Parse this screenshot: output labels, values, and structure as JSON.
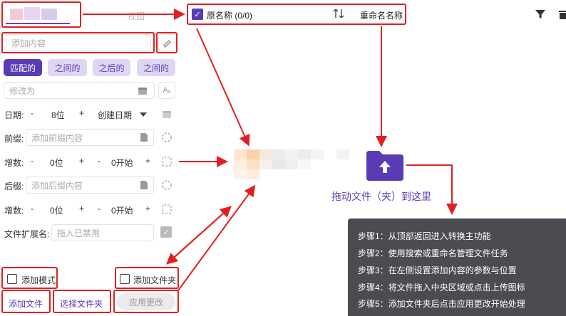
{
  "tabs": {
    "second": "视图"
  },
  "add_content": {
    "placeholder": "添加内容"
  },
  "modes": [
    {
      "label": "匹配的",
      "active": true
    },
    {
      "label": "之间的",
      "active": false
    },
    {
      "label": "之后的",
      "active": false
    },
    {
      "label": "之间的",
      "active": false
    }
  ],
  "modify": {
    "placeholder": "修改为",
    "case_toggle": "Aₒ"
  },
  "date": {
    "label": "日期:",
    "minus": "-",
    "value": "8位",
    "plus": "+",
    "type": "创建日期"
  },
  "prefix": {
    "label": "前缀:",
    "placeholder": "添加前缀内容"
  },
  "increment1": {
    "label": "增数:",
    "minus1": "-",
    "digits": "0位",
    "plus1": "+",
    "minus2": "-",
    "start": "0开始",
    "plus2": "+"
  },
  "suffix": {
    "label": "后缀:",
    "placeholder": "添加后缀内容"
  },
  "increment2": {
    "label": "增数:",
    "minus1": "-",
    "digits": "0位",
    "plus1": "+",
    "minus2": "-",
    "start": "0开始",
    "plus2": "+"
  },
  "extension": {
    "label": "文件扩展名:",
    "placeholder": "拖入已禁用"
  },
  "options": {
    "add_mode": "添加模式",
    "add_folder": "添加文件夹"
  },
  "actions": {
    "add_file": "添加文件",
    "select_folder": "选择文件夹",
    "apply": "应用更改"
  },
  "list_header": {
    "original_name": "原名称 (0/0)",
    "rename_name": "重命名名称"
  },
  "drop": {
    "text": "拖动文件（夹）到这里"
  },
  "tips": [
    "步骤1：从顶部返回进入转换主功能",
    "步骤2：使用搜索或重命名管理文件任务",
    "步骤3：在左侧设置添加内容的参数与位置",
    "步骤4：将文件拖入中央区域或点击上传图标",
    "步骤5：添加文件夹后点击应用更改开始处理"
  ],
  "colors": {
    "accent": "#5b3bb5",
    "annotation": "#e02020",
    "tips_bg": "#4b4b52"
  }
}
